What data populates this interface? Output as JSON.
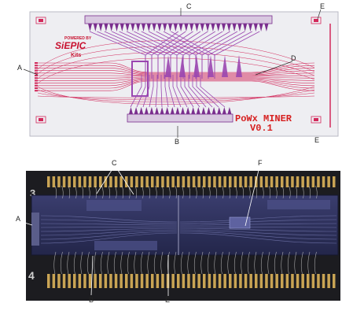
{
  "figure": {
    "top_panel": {
      "logo": {
        "line1": "POWERED BY",
        "line2": "SiEPIC",
        "line3": "Kits"
      },
      "chip_title": "PoWx MINER",
      "chip_version": "V0.1",
      "colors": {
        "substrate": "#eeeef2",
        "waveguide": "#d2285a",
        "metal": "#9a46b0",
        "pad": "#7a2e8e",
        "title": "#d62020"
      }
    },
    "bottom_panel": {
      "colors": {
        "board": "#1c1c20",
        "chip": "#2b2e55",
        "wire": "#c9c9c9",
        "gold": "#c9a454"
      }
    },
    "callouts": {
      "top": {
        "C": "C",
        "E_top": "E",
        "A": "A",
        "D": "D",
        "B": "B",
        "E_bottom": "E"
      },
      "bottom": {
        "C": "C",
        "F": "F",
        "A": "A",
        "B": "B",
        "E": "E"
      }
    }
  }
}
